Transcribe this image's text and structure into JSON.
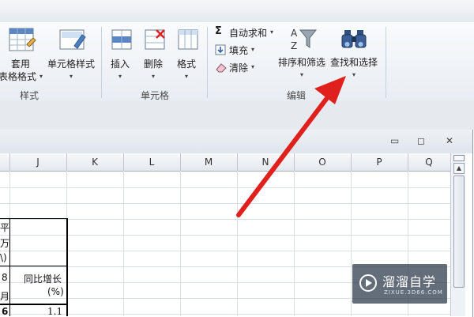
{
  "ribbon": {
    "styles_group": {
      "apply_table_label_top": "套用",
      "apply_table_label_bottom": "表格格式",
      "cell_styles_label": "单元格样式",
      "group_label": "样式"
    },
    "cells_group": {
      "insert_label": "插入",
      "delete_label": "删除",
      "format_label": "格式",
      "group_label": "单元格"
    },
    "editing_group": {
      "autosum_label": "自动求和",
      "fill_label": "填充",
      "clear_label": "清除",
      "sort_filter_label": "排序和筛选",
      "find_select_label": "查找和选择",
      "group_label": "编辑"
    }
  },
  "window_controls": {
    "minimize": "▭",
    "restore": "◻",
    "close": "✕"
  },
  "columns": [
    "J",
    "K",
    "L",
    "M",
    "N",
    "O",
    "P",
    "Q"
  ],
  "sheet": {
    "header_fragment_1": "平",
    "header_fragment_2": "万",
    "header_fragment_3": "\\)",
    "row_fragment_8": "8",
    "row_fragment_month": "月",
    "yoy_label_line1": "同比增长",
    "yoy_label_line2": "(%)",
    "value_fragment_6": "6",
    "value_yoy": "1.1"
  },
  "watermark": {
    "brand": "溜溜自学",
    "url": "ZIXUE.3D66.COM"
  },
  "colors": {
    "annotation_arrow": "#e0201c",
    "ribbon_bg": "#eef2f6"
  }
}
